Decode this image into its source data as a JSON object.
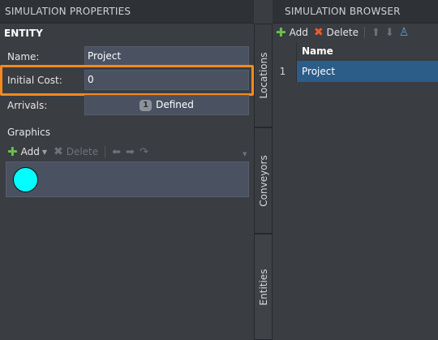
{
  "left_panel": {
    "title": "SIMULATION PROPERTIES",
    "section": "ENTITY",
    "properties": {
      "name_label": "Name:",
      "name_value": "Project",
      "cost_label": "Initial Cost:",
      "cost_value": "0",
      "arrivals_label": "Arrivals:",
      "arrivals_count": "1",
      "arrivals_text": "Defined"
    },
    "graphics": {
      "label": "Graphics",
      "add_label": "Add",
      "delete_label": "Delete",
      "circle_color": "#00ffff"
    }
  },
  "tabs": [
    "Locations",
    "Conveyors",
    "Entities"
  ],
  "right_panel": {
    "title": "SIMULATION BROWSER",
    "toolbar": {
      "add_label": "Add",
      "delete_label": "Delete"
    },
    "grid": {
      "column": "Name",
      "rows": [
        {
          "num": "1",
          "name": "Project"
        }
      ]
    }
  },
  "colors": {
    "highlight": "#f5891f",
    "selected_row": "#2c5d88",
    "field_bg": "#4a5261"
  }
}
